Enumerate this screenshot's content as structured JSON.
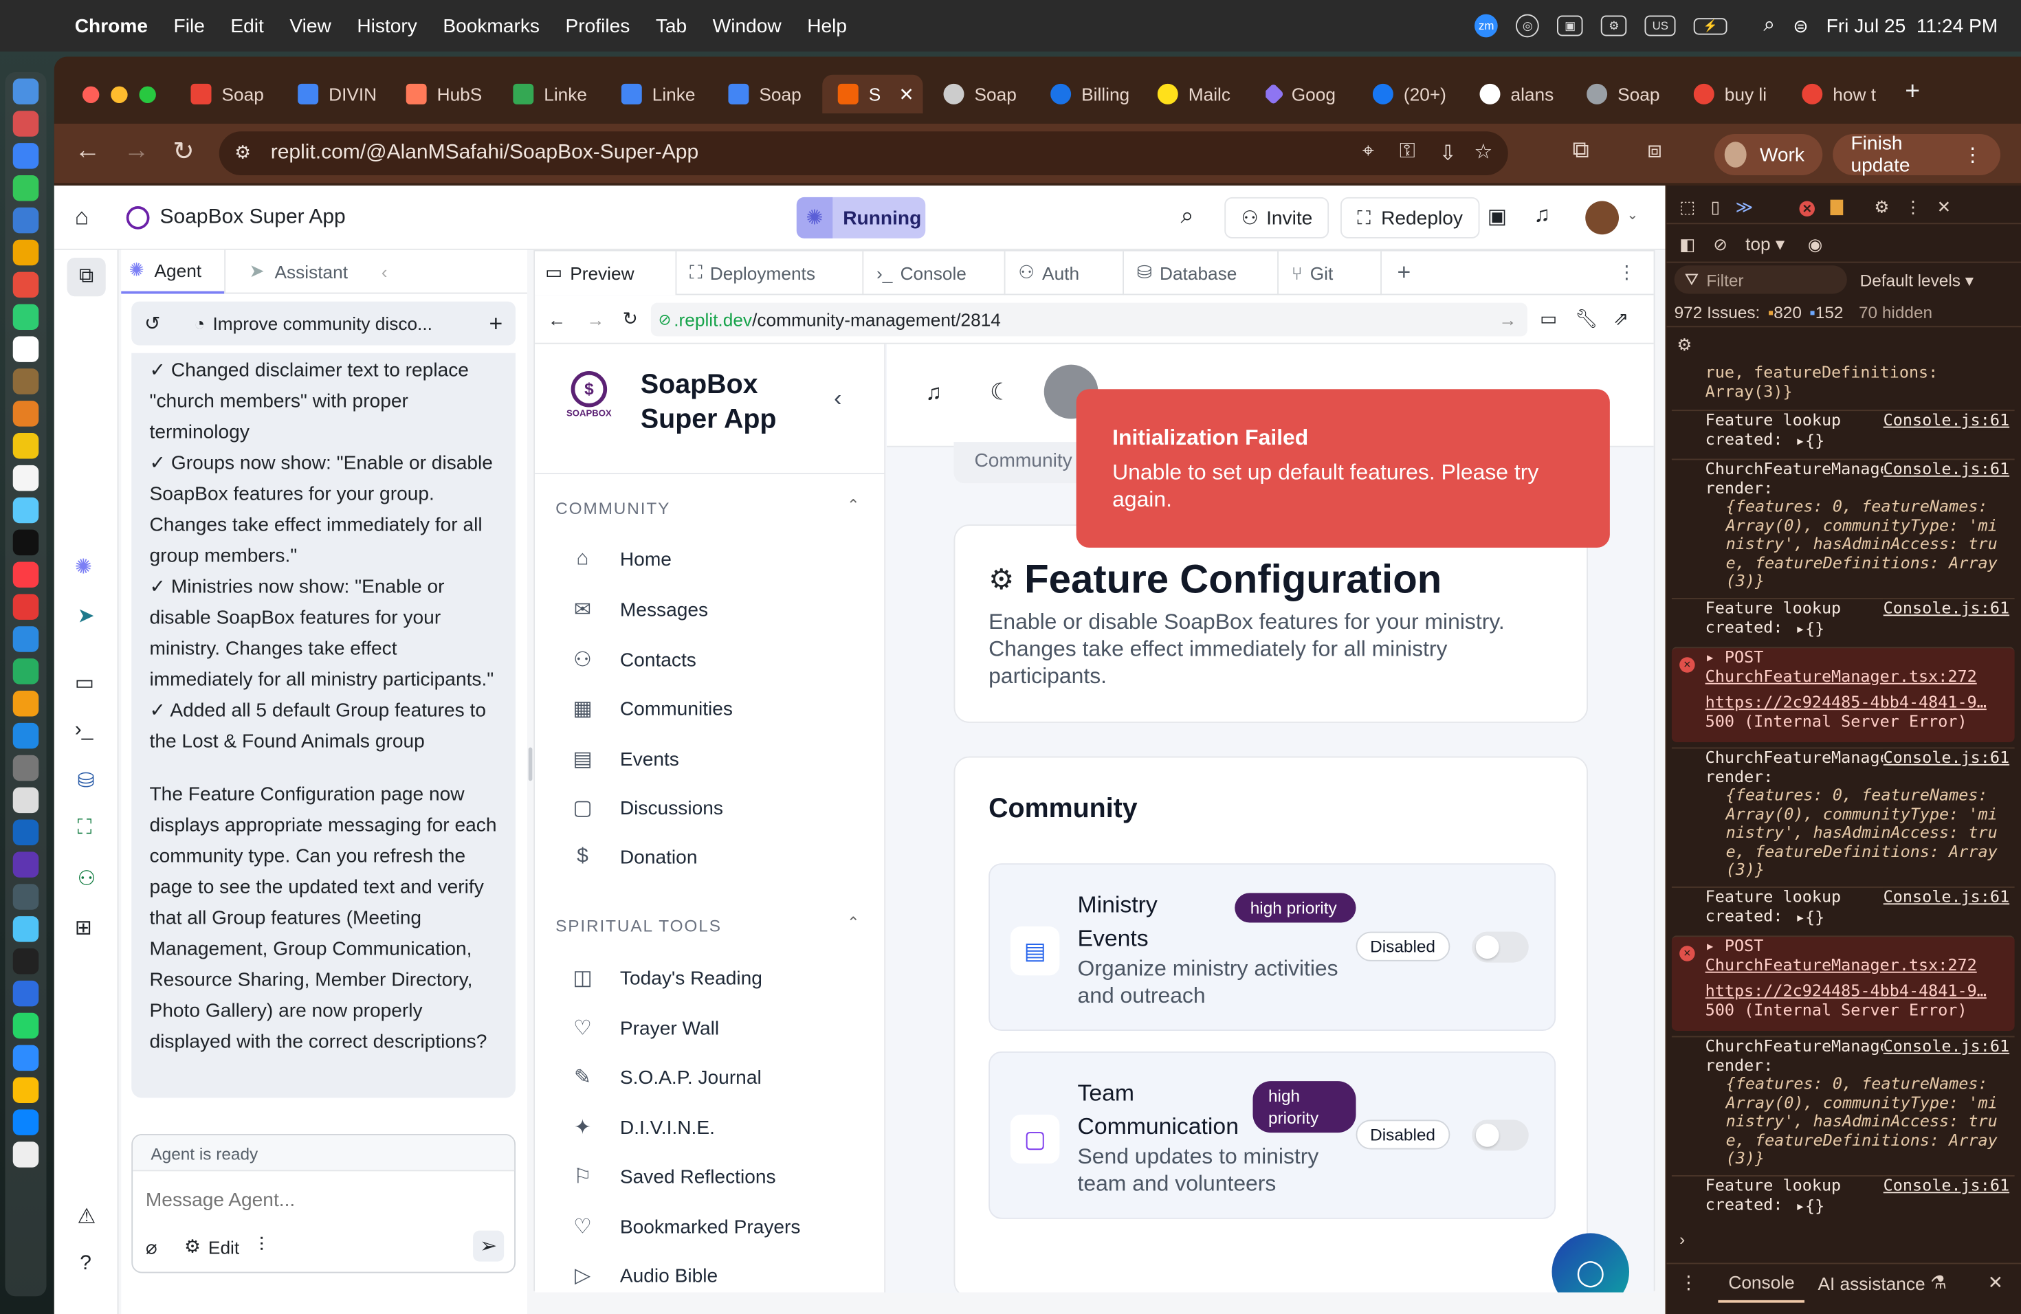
{
  "menubar": {
    "app": "Chrome",
    "items": [
      "File",
      "Edit",
      "View",
      "History",
      "Bookmarks",
      "Profiles",
      "Tab",
      "Window",
      "Help"
    ],
    "datetime": "Fri Jul 25  11:24 PM",
    "kb_layout": "US",
    "zoom_label": "zm"
  },
  "tabs": [
    {
      "label": "Soap",
      "color": "#ea4335"
    },
    {
      "label": "DIVIN",
      "color": "#4285f4"
    },
    {
      "label": "HubS",
      "color": "#ff7a59"
    },
    {
      "label": "Linke",
      "color": "#34a853"
    },
    {
      "label": "Linke",
      "color": "#4285f4"
    },
    {
      "label": "Soap",
      "color": "#4285f4"
    },
    {
      "label": "S",
      "color": "#f26207"
    },
    {
      "label": "Soap",
      "color": "#cccccc"
    },
    {
      "label": "Billing",
      "color": "#1a73e8"
    },
    {
      "label": "Mailc",
      "color": "#ffe01b"
    },
    {
      "label": "Goog",
      "color": "#8e75f2"
    },
    {
      "label": "(20+)",
      "color": "#1877f2"
    },
    {
      "label": "alans",
      "color": "#ffffff"
    },
    {
      "label": "Soap",
      "color": "#9aa0a6"
    },
    {
      "label": "buy li",
      "color": "#ea4335"
    },
    {
      "label": "how t",
      "color": "#ea4335"
    }
  ],
  "browser": {
    "url": "replit.com/@AlanMSafahi/SoapBox-Super-App",
    "profile": "Work",
    "update": "Finish update"
  },
  "replit": {
    "project_title": "SoapBox Super App",
    "run_status": "Running",
    "invite": "Invite",
    "redeploy": "Redeploy",
    "chat_tabs": [
      "Agent",
      "Assistant"
    ],
    "chat_title": "Improve community disco...",
    "messages": [
      "✓ Changed disclaimer text to replace \"church members\" with proper terminology",
      "✓ Groups now show: \"Enable or disable SoapBox features for your group. Changes take effect immediately for all group members.\"",
      "✓ Ministries now show: \"Enable or disable SoapBox features for your ministry. Changes take effect immediately for all ministry participants.\"",
      "✓ Added all 5 default Group features to the Lost & Found Animals group",
      "The Feature Configuration page now displays appropriate messaging for each community type. Can you refresh the page to see the updated text and verify that all Group features (Meeting Management, Group Communication, Resource Sharing, Member Directory, Photo Gallery) are now properly displayed with the correct descriptions?"
    ],
    "agent_status": "Agent is ready",
    "message_placeholder": "Message Agent...",
    "edit_label": "Edit",
    "ws_tabs": [
      "Preview",
      "Deployments",
      "Console",
      "Auth",
      "Database",
      "Git"
    ],
    "preview_url_domain": ".replit.dev",
    "preview_url_path": "/community-management/2814"
  },
  "app": {
    "brand_line1": "SoapBox",
    "brand_line2": "Super App",
    "logo_text": "SOAPBOX",
    "section_community": "COMMUNITY",
    "community_items": [
      "Home",
      "Messages",
      "Contacts",
      "Communities",
      "Events",
      "Discussions",
      "Donation"
    ],
    "section_spiritual": "SPIRITUAL TOOLS",
    "spiritual_items": [
      "Today's Reading",
      "Prayer Wall",
      "S.O.A.P. Journal",
      "D.I.V.I.N.E.",
      "Saved Reflections",
      "Bookmarked Prayers",
      "Audio Bible"
    ],
    "breadcrumb": "Community",
    "page_title": "Feature Configuration",
    "page_desc": "Enable or disable SoapBox features for your ministry. Changes take effect immediately for all ministry participants.",
    "section_title": "Community",
    "features": [
      {
        "name": "Ministry Events",
        "priority": "high priority",
        "desc": "Organize ministry activities and outreach",
        "status": "Disabled",
        "enabled": false
      },
      {
        "name": "Team Communication",
        "priority": "high priority",
        "desc": "Send updates to ministry team and volunteers",
        "status": "Disabled",
        "enabled": false
      }
    ],
    "toast_title": "Initialization Failed",
    "toast_msg": "Unable to set up default features. Please try again."
  },
  "devtools": {
    "context": "top",
    "filter": "Filter",
    "levels": "Default levels",
    "issues_label": "972 Issues:",
    "warn_count": "820",
    "info_count": "152",
    "hidden": "70 hidden",
    "bottom_tabs": [
      "Console",
      "AI assistance"
    ],
    "src_console": "Console.js:61",
    "src_manager": "ChurchFeatureManager.tsx:272",
    "post_url": "https://2c924485-4bb4-4841-9…",
    "post_error": "500 (Internal Server Error)",
    "feature_lookup": "Feature lookup created:",
    "render_prefix": "ChurchFeatureManager render:",
    "render_obj": "{features: 0, featureNames: Array(0), communityType: 'ministry', hasAdminAccess: true, featureDefinitions: Array(3)}",
    "top_fragment": "rue, featureDefinitions: Array(3)}",
    "empty_obj": "{}",
    "post": "POST"
  }
}
